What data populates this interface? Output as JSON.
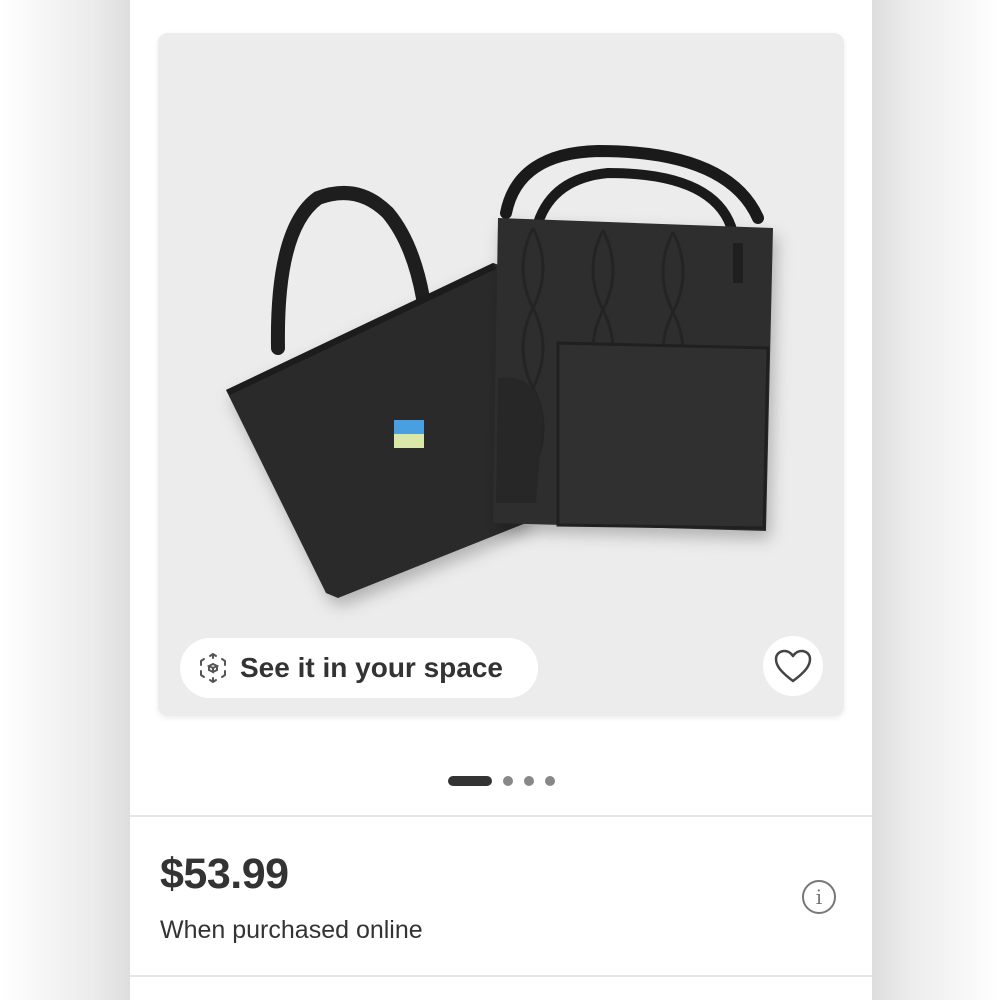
{
  "product": {
    "image_alt": "Black quilted tote bags",
    "ar_button_label": "See it in your space",
    "ar_icon": "cube-ar-icon",
    "favorite_icon": "heart-outline-icon"
  },
  "carousel": {
    "total_slides": 4,
    "active_index": 0
  },
  "pricing": {
    "price": "$53.99",
    "note": "When purchased online",
    "info_icon": "info-icon",
    "info_glyph": "i"
  },
  "colors": {
    "image_bg": "#ececec",
    "text": "#333333",
    "indicator_active": "#333333",
    "indicator_inactive": "#888888"
  }
}
